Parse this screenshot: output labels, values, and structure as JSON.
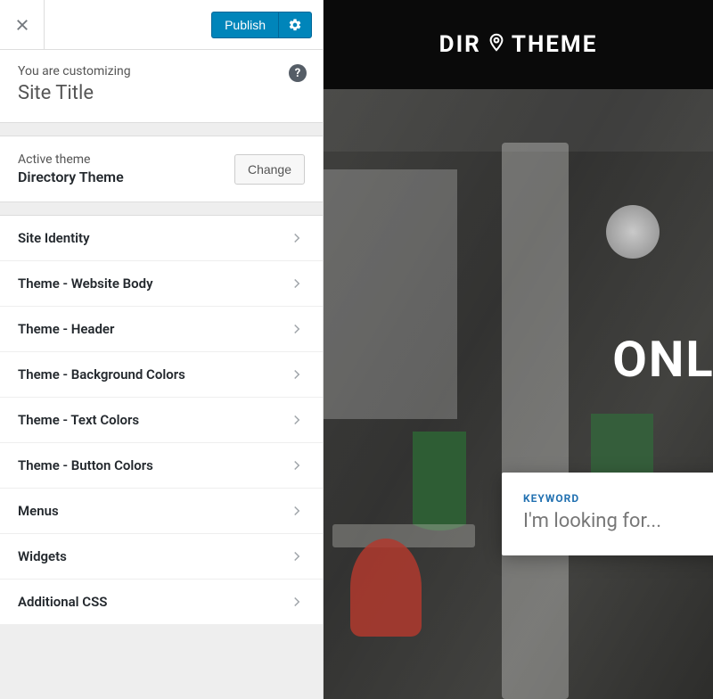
{
  "colors": {
    "accent": "#0085ba",
    "accent_border": "#006799"
  },
  "toolbar": {
    "publish_label": "Publish"
  },
  "context": {
    "label": "You are customizing",
    "title": "Site Title"
  },
  "theme": {
    "label": "Active theme",
    "name": "Directory Theme",
    "change_label": "Change"
  },
  "menu": {
    "items": [
      {
        "label": "Site Identity"
      },
      {
        "label": "Theme - Website Body"
      },
      {
        "label": "Theme - Header"
      },
      {
        "label": "Theme - Background Colors"
      },
      {
        "label": "Theme - Text Colors"
      },
      {
        "label": "Theme - Button Colors"
      },
      {
        "label": "Menus"
      },
      {
        "label": "Widgets"
      },
      {
        "label": "Additional CSS"
      }
    ]
  },
  "preview": {
    "logo_left": "DIR",
    "logo_right": "THEME",
    "hero_title": "ONLI",
    "search": {
      "label": "KEYWORD",
      "placeholder": "I'm looking for..."
    }
  }
}
